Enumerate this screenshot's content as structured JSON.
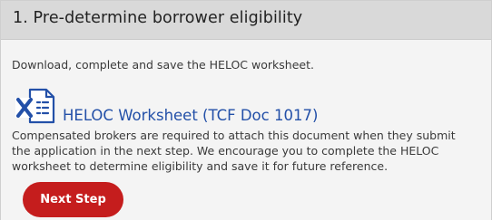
{
  "section": {
    "title": "1. Pre-determine borrower eligibility",
    "intro": "Download, complete and save the HELOC worksheet.",
    "document": {
      "icon": "excel-file-icon",
      "link_text": "HELOC Worksheet (TCF Doc 1017)"
    },
    "description_lines": [
      "Compensated brokers are required to attach this document when they submit",
      "the application in the next step. We encourage you to complete the HELOC",
      "worksheet to determine eligibility and save it for future reference."
    ],
    "next_button_label": "Next Step"
  },
  "colors": {
    "header_bg": "#d9d9d9",
    "panel_bg": "#f4f4f4",
    "link": "#2350a8",
    "button": "#c51d1d"
  }
}
